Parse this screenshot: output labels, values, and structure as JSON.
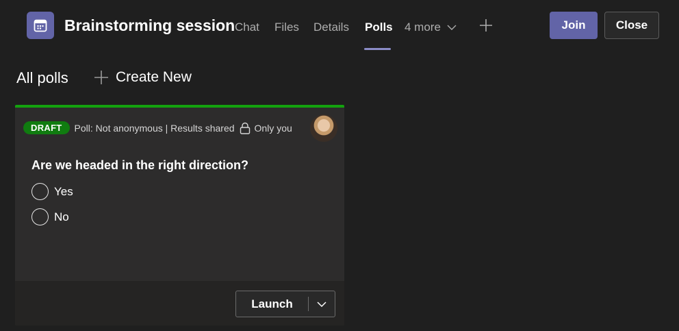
{
  "header": {
    "meeting_title": "Brainstorming session",
    "tabs": [
      {
        "label": "Chat",
        "active": false
      },
      {
        "label": "Files",
        "active": false
      },
      {
        "label": "Details",
        "active": false
      },
      {
        "label": "Polls",
        "active": true
      }
    ],
    "more_tabs_label": "4 more",
    "join_label": "Join",
    "close_label": "Close",
    "accent_color": "#6264a7"
  },
  "polls_page": {
    "heading": "All polls",
    "create_new_label": "Create New"
  },
  "poll_card": {
    "status_badge": "DRAFT",
    "status_color": "#107c10",
    "meta": "Poll: Not anonymous | Results shared",
    "visibility": "Only you",
    "question": "Are we headed in the right direction?",
    "options": [
      "Yes",
      "No"
    ],
    "launch_label": "Launch"
  }
}
